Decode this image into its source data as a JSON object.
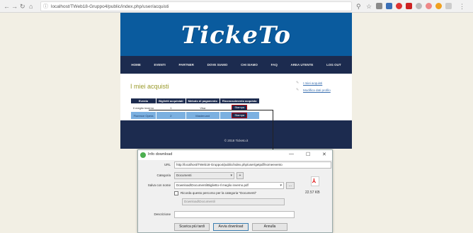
{
  "browser": {
    "url": "localhost/TWeb18-Gruppo4/public/index.php/user/acquisti"
  },
  "site": {
    "logo": "TickeTo",
    "menu": [
      "HOME",
      "EVENTI",
      "PARTNER",
      "DOVE SIAMO",
      "CHI SIAMO",
      "FAQ",
      "AREA UTENTE",
      "LOG OUT"
    ],
    "page_title": "I miei acquisti",
    "side_links": [
      "I miei acquisti",
      "Modifica dati profilo"
    ],
    "table": {
      "headers": [
        "Evento",
        "Biglietti acquistati",
        "Metodo di pagamento",
        "Riconoscimento acquisto"
      ],
      "rows": [
        [
          "Il meglio inverno",
          "1",
          "Visa",
          "Stampa"
        ],
        [
          "Florence Opera",
          "2",
          "Mastercard",
          "Stampa"
        ]
      ]
    },
    "footer": "© 2018 Ticketo.it"
  },
  "dialog": {
    "title": "Info download",
    "url_label": "URL",
    "url_value": "http://localhost/TWeb18-Gruppo4/public/index.php/user/getpdf/nomeevento",
    "category_label": "Categoria",
    "category_value": "Documenti",
    "plus_label": "+",
    "save_label": "Salva con nome",
    "save_value": "Download\\Documenti\\Biglietto-Il meglio inverno.pdf",
    "browse_label": "...",
    "remember_label": "Ricorda questo percorso per la categoria \"Documenti\"",
    "path_value": "Download\\Documenti\\",
    "description_label": "Descrizione",
    "file_size": "22.57 KB",
    "btn_later": "Scarica più tardi",
    "btn_start": "Avvia download",
    "btn_cancel": "Annulla"
  }
}
